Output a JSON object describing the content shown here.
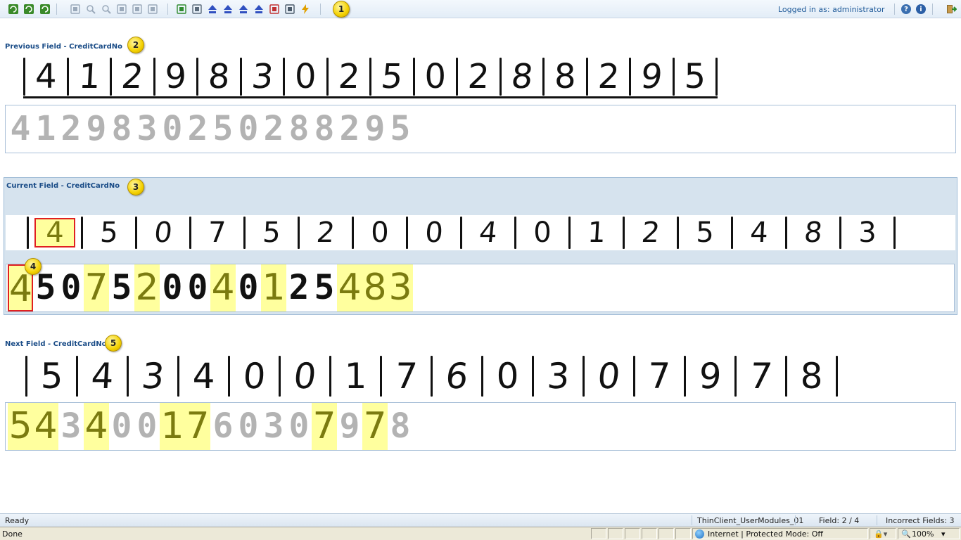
{
  "toolbar": {
    "icons": [
      "refresh-batch-icon",
      "refresh-icon",
      "refresh-all-icon",
      "page-icon",
      "zoom-in-icon",
      "zoom-out-icon",
      "pan-icon",
      "fit-width-icon",
      "fit-height-icon",
      "next-task-icon",
      "ocr-icon",
      "first-field-icon",
      "previous-field-icon",
      "next-field-icon",
      "last-field-icon",
      "flag-icon",
      "keyboard-icon",
      "lightning-icon"
    ],
    "login_text": "Logged in as: administrator",
    "badge": "1"
  },
  "previous": {
    "label": "Previous Field - CreditCardNo",
    "badge": "2",
    "handwritten_digits": [
      "4",
      "1",
      "2",
      "9",
      "8",
      "3",
      "0",
      "2",
      "5",
      "0",
      "2",
      "8",
      "8",
      "2",
      "9",
      "5"
    ],
    "recognized": [
      "4",
      "1",
      "2",
      "9",
      "8",
      "3",
      "0",
      "2",
      "5",
      "0",
      "2",
      "8",
      "8",
      "2",
      "9",
      "5"
    ]
  },
  "current": {
    "label": "Current Field - CreditCardNo",
    "badge": "3",
    "badge_inline": "4",
    "handwritten_digits": [
      "4",
      "5",
      "0",
      "7",
      "5",
      "2",
      "0",
      "0",
      "4",
      "0",
      "1",
      "2",
      "5",
      "4",
      "8",
      "3"
    ],
    "recognized": [
      "4",
      "5",
      "0",
      "7",
      "5",
      "2",
      "0",
      "0",
      "4",
      "0",
      "1",
      "2",
      "5",
      "4",
      "8",
      "3"
    ],
    "highlighted_indices": [
      0,
      3,
      5,
      8,
      10,
      13,
      14,
      15
    ]
  },
  "next": {
    "label": "Next Field - CreditCardNo",
    "badge": "5",
    "handwritten_digits": [
      "5",
      "4",
      "3",
      "4",
      "0",
      "0",
      "1",
      "7",
      "6",
      "0",
      "3",
      "0",
      "7",
      "9",
      "7",
      "8"
    ],
    "recognized": [
      "5",
      "4",
      "3",
      "4",
      "0",
      "0",
      "1",
      "7",
      "6",
      "0",
      "3",
      "0",
      "7",
      "9",
      "7",
      "8"
    ],
    "highlighted_indices": [
      0,
      1,
      3,
      6,
      7,
      12,
      14
    ]
  },
  "status1": {
    "ready": "Ready",
    "module": "ThinClient_UserModules_01",
    "field": "Field: 2 / 4",
    "incorrect": "Incorrect Fields: 3"
  },
  "status2": {
    "done": "Done",
    "zone": "Internet | Protected Mode: Off",
    "zoom": "100%"
  },
  "colors": {
    "accent": "#1a4c87",
    "highlight": "#ffff9e",
    "selection": "#e02020",
    "panel": "#d6e3ee"
  }
}
